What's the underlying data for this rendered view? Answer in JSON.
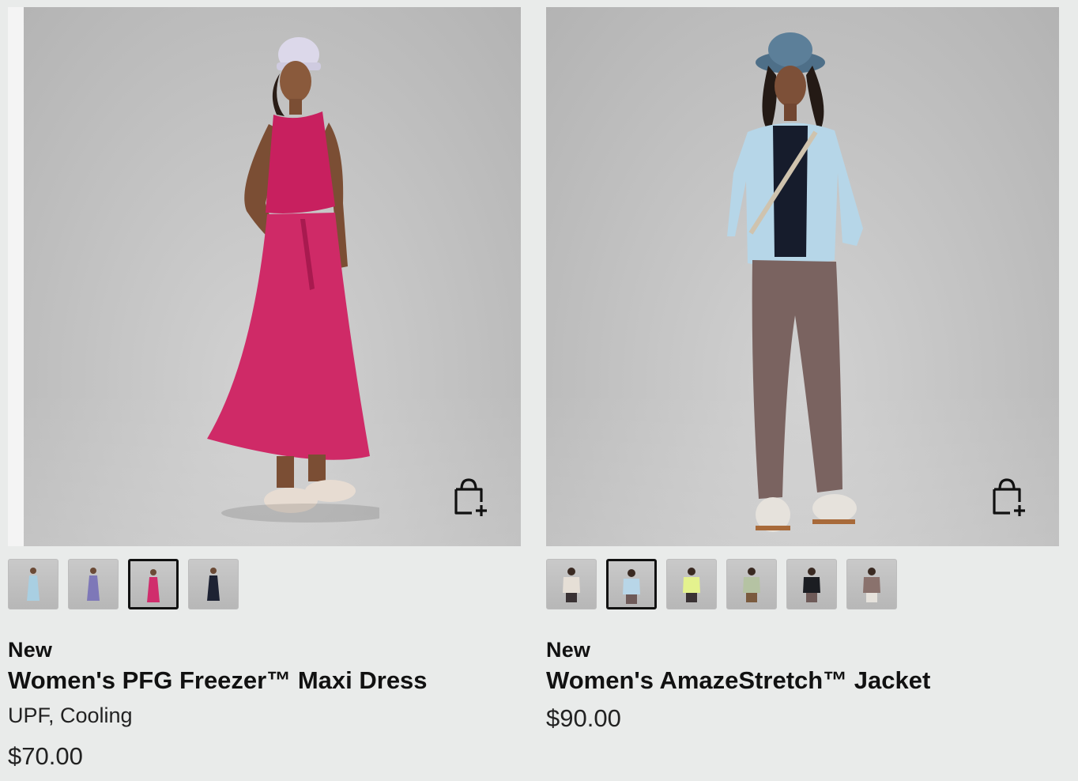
{
  "products": [
    {
      "badge": "New",
      "title": "Women's PFG Freezer™ Maxi Dress",
      "features": "UPF, Cooling",
      "price": "$70.00",
      "image_icon": "model-in-maxi-dress-image",
      "add_to_bag_icon": "shopping-bag-plus-icon",
      "swatches": [
        {
          "color": "#a9cfe2",
          "selected": false
        },
        {
          "color": "#7e78b8",
          "selected": false
        },
        {
          "color": "#d02d6c",
          "selected": true
        },
        {
          "color": "#1d2233",
          "selected": false
        }
      ]
    },
    {
      "badge": "New",
      "title": "Women's AmazeStretch™ Jacket",
      "features": "",
      "price": "$90.00",
      "image_icon": "model-in-jacket-image",
      "add_to_bag_icon": "shopping-bag-plus-icon",
      "swatches": [
        {
          "color": "#e6dfd6",
          "selected": false
        },
        {
          "color": "#b8d6e8",
          "selected": true
        },
        {
          "color": "#e4f28e",
          "selected": false
        },
        {
          "color": "#b5c3a3",
          "selected": false
        },
        {
          "color": "#1b1d22",
          "selected": false
        },
        {
          "color": "#8a726d",
          "selected": false
        }
      ]
    }
  ]
}
